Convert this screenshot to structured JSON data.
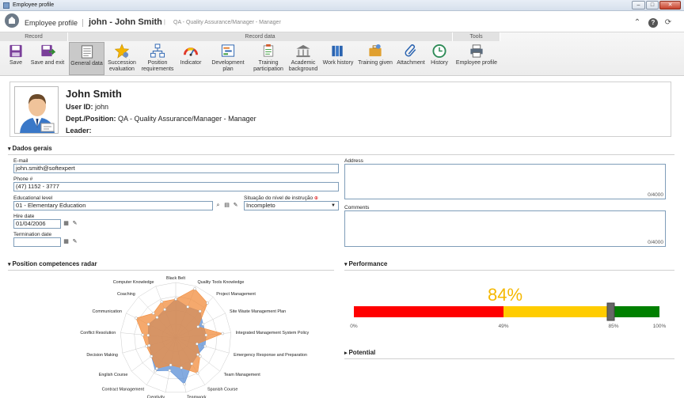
{
  "window": {
    "title": "Employee profile"
  },
  "header": {
    "app_title": "Employee profile",
    "record_name": "john - John Smith",
    "separator": "|",
    "dept": "QA - Quality Assurance/Manager - Manager"
  },
  "ribbon": {
    "groups": {
      "record": "Record",
      "record_data": "Record data",
      "tools": "Tools"
    },
    "buttons": {
      "save": "Save",
      "save_exit": "Save and exit",
      "general": "General data",
      "succession1": "Succession",
      "succession2": "evaluation",
      "position1": "Position",
      "position2": "requirements",
      "indicator": "Indicator",
      "devplan": "Development plan",
      "training_part1": "Training",
      "training_part2": "participation",
      "academic1": "Academic",
      "academic2": "background",
      "work_history": "Work history",
      "training_given": "Training given",
      "attachment": "Attachment",
      "history": "History",
      "emp_profile": "Employee profile"
    }
  },
  "profile": {
    "name": "John Smith",
    "user_id_label": "User ID:",
    "user_id": "john",
    "dept_label": "Dept./Position:",
    "dept": "QA - Quality Assurance/Manager - Manager",
    "leader_label": "Leader:",
    "leader": ""
  },
  "general": {
    "section_title": "Dados gerais",
    "email_label": "E-mail",
    "email": "john.smith@softexpert",
    "phone_label": "Phone #",
    "phone": "(47) 1152 - 3777",
    "edu_label": "Educational level",
    "edu": "01 - Elementary Education",
    "situacao_label": "Situação do nível de instrução",
    "situacao": "Incompleto",
    "hire_label": "Hire date",
    "hire": "01/04/2006",
    "term_label": "Termination date",
    "term": "",
    "address_label": "Address",
    "address_count": "0/4000",
    "comments_label": "Comments",
    "comments_count": "0/4000"
  },
  "radar": {
    "section_title": "Position competences radar",
    "axes": [
      "Black Belt",
      "Quality Tools Knowledge",
      "Project Management",
      "Site Waste Management Plan",
      "Integrated Management System Policy",
      "Emergency Response and Preparation",
      "Team Management",
      "Spanish Course",
      "Teamwork",
      "Creativity",
      "Contract Management",
      "English Course",
      "Decision Making",
      "Conflict Resolution",
      "Communication",
      "Coaching",
      "Computer Knowledge"
    ],
    "series_orange": [
      0.7,
      0.95,
      0.85,
      0.45,
      0.85,
      0.4,
      0.55,
      0.75,
      0.55,
      0.5,
      0.65,
      0.55,
      0.55,
      0.6,
      0.8,
      0.6,
      0.7
    ],
    "series_blue": [
      0.7,
      0.6,
      0.65,
      0.55,
      0.55,
      0.55,
      0.5,
      0.55,
      0.85,
      0.6,
      0.7,
      0.55,
      0.5,
      0.5,
      0.55,
      0.5,
      0.55
    ],
    "colors": {
      "orange": "#f28c3c",
      "blue": "#5b8fd6"
    }
  },
  "performance": {
    "section_title": "Performance",
    "value_text": "84%",
    "value": 84,
    "ticks": [
      "0%",
      "49%",
      "85%",
      "100%"
    ],
    "colors": {
      "red": "#ff0000",
      "yellow": "#ffcc00",
      "green": "#008000",
      "value": "#f5b800"
    }
  },
  "potential": {
    "section_title": "Potential"
  }
}
